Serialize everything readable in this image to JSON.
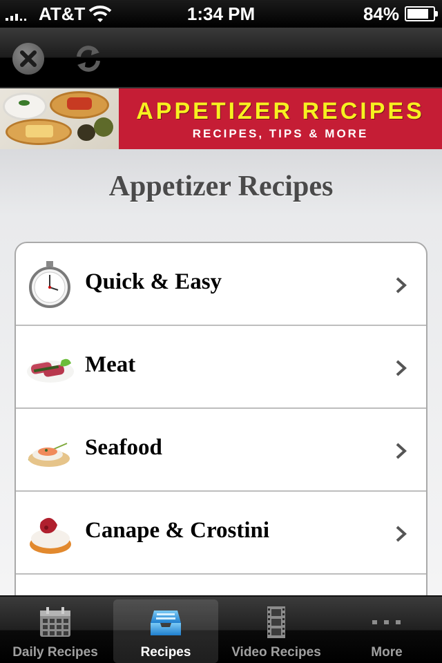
{
  "status_bar": {
    "carrier": "AT&T",
    "time": "1:34 PM",
    "battery_percent": "84%",
    "battery_level": 0.84
  },
  "toolbar": {
    "buttons": [
      {
        "icon": "close-icon"
      },
      {
        "icon": "refresh-icon"
      }
    ]
  },
  "banner": {
    "title": "APPETIZER RECIPES",
    "subtitle": "RECIPES, TIPS & MORE"
  },
  "main": {
    "title": "Appetizer Recipes",
    "categories": [
      {
        "label": "Quick & Easy",
        "icon": "stopwatch-icon"
      },
      {
        "label": "Meat",
        "icon": "meat-roll-icon"
      },
      {
        "label": "Seafood",
        "icon": "seafood-canape-icon"
      },
      {
        "label": "Canape & Crostini",
        "icon": "canape-icon"
      }
    ]
  },
  "tabbar": {
    "tabs": [
      {
        "label": "Daily Recipes",
        "icon": "calendar-icon",
        "active": false
      },
      {
        "label": "Recipes",
        "icon": "inbox-tray-icon",
        "active": true
      },
      {
        "label": "Video Recipes",
        "icon": "film-icon",
        "active": false
      },
      {
        "label": "More",
        "icon": "more-dots-icon",
        "active": false
      }
    ]
  },
  "colors": {
    "banner_red": "#c51d35",
    "banner_title_yellow": "#f7f020",
    "active_tab_blue": "#2f9be0"
  }
}
